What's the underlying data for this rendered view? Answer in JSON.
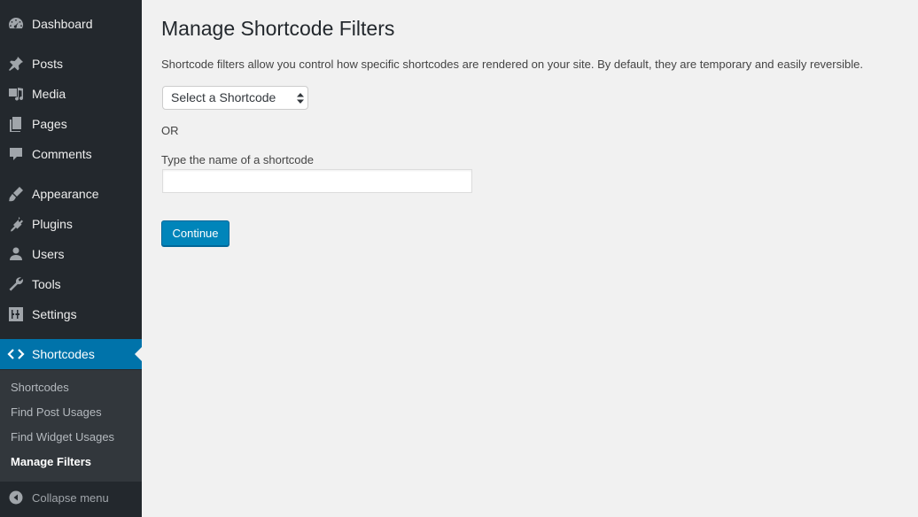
{
  "sidebar": {
    "menu": [
      {
        "label": "Dashboard",
        "icon": "dashboard-icon"
      },
      {
        "label": "Posts",
        "icon": "pushpin-icon"
      },
      {
        "label": "Media",
        "icon": "media-icon"
      },
      {
        "label": "Pages",
        "icon": "pages-icon"
      },
      {
        "label": "Comments",
        "icon": "comment-icon"
      },
      {
        "label": "Appearance",
        "icon": "paintbrush-icon"
      },
      {
        "label": "Plugins",
        "icon": "plug-icon"
      },
      {
        "label": "Users",
        "icon": "user-icon"
      },
      {
        "label": "Tools",
        "icon": "wrench-icon"
      },
      {
        "label": "Settings",
        "icon": "sliders-icon"
      },
      {
        "label": "Shortcodes",
        "icon": "code-brackets-icon"
      }
    ],
    "submenu": [
      {
        "label": "Shortcodes"
      },
      {
        "label": "Find Post Usages"
      },
      {
        "label": "Find Widget Usages"
      },
      {
        "label": "Manage Filters"
      }
    ],
    "collapse_label": "Collapse menu"
  },
  "main": {
    "title": "Manage Shortcode Filters",
    "description": "Shortcode filters allow you control how specific shortcodes are rendered on your site. By default, they are temporary and easily reversible.",
    "select_value": "Select a Shortcode",
    "or_text": "OR",
    "input_label": "Type the name of a shortcode",
    "input_value": "",
    "continue_label": "Continue"
  },
  "colors": {
    "sidebar_bg": "#23282d",
    "active_bg": "#0073aa",
    "submenu_bg": "#32373c",
    "button_bg": "#0085ba",
    "page_bg": "#f1f1f1"
  }
}
